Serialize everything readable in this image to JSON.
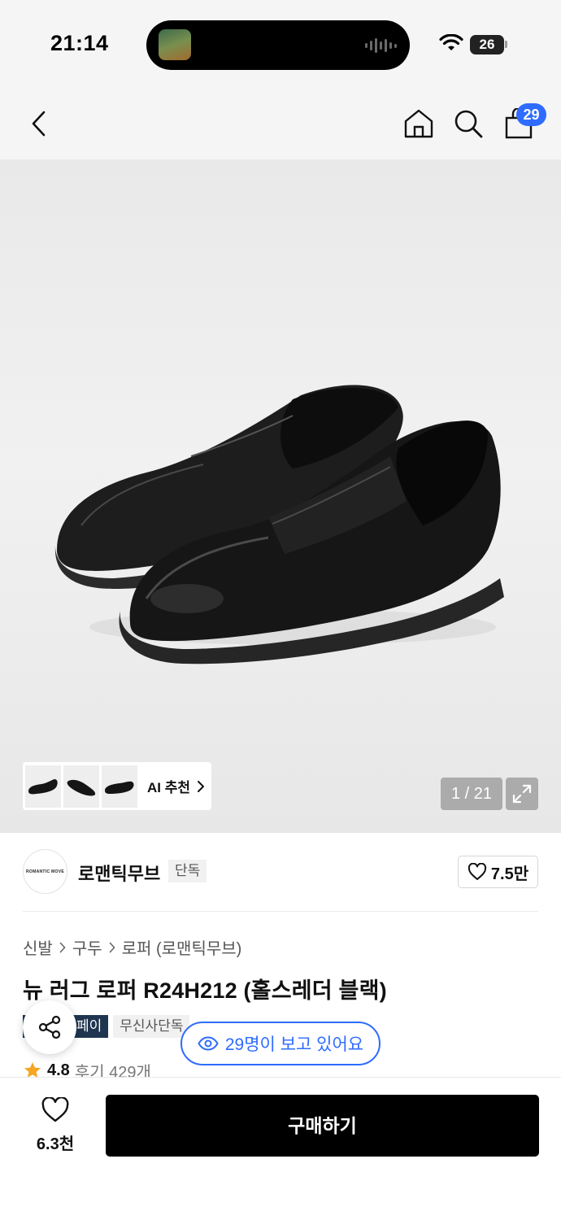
{
  "status_bar": {
    "time": "21:14",
    "battery": "26"
  },
  "nav": {
    "cart_count": "29"
  },
  "gallery": {
    "ai_recommend_label": "AI 추천",
    "pager": "1 / 21"
  },
  "brand": {
    "logo_text": "ROMANTIC MOVE",
    "name": "로맨틱무브",
    "tag": "단독",
    "likes": "7.5만"
  },
  "breadcrumb": [
    "신발",
    "구두",
    "로퍼 (로맨틱무브)"
  ],
  "product": {
    "title": "뉴 러그 로퍼 R24H212 (홀스레더 블랙)",
    "tags": [
      "페이",
      "무신사단독"
    ],
    "viewers": "29명이 보고 있어요",
    "rating": "4.8",
    "reviews": "후기 429개"
  },
  "bottom": {
    "wish_count": "6.3천",
    "buy_label": "구매하기"
  },
  "colors": {
    "accent": "#2f6bff",
    "buy_button": "#000000",
    "tag_dark": "#1f3550"
  }
}
